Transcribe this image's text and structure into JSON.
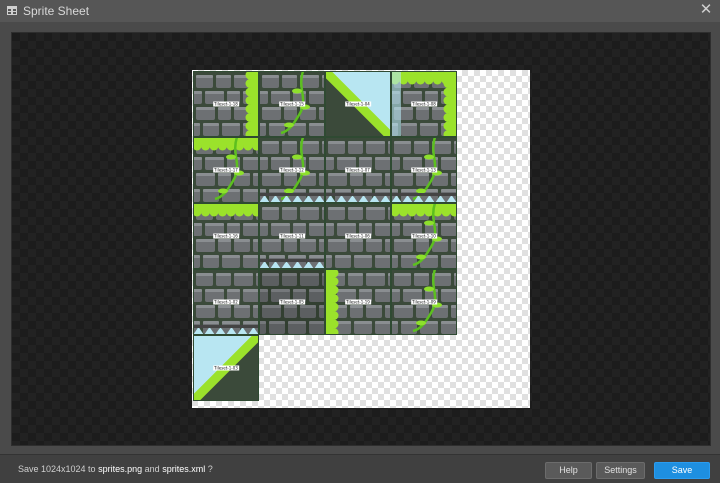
{
  "window": {
    "title": "Sprite Sheet",
    "close_glyph": "✕"
  },
  "sheet": {
    "tiles": [
      {
        "label": "Tileset-1-18",
        "variant": "wall-grass-right"
      },
      {
        "label": "Tileset-1-15",
        "variant": "wall-vine"
      },
      {
        "label": "Tileset-1-04",
        "variant": "slope-down"
      },
      {
        "label": "Tileset-1-08",
        "variant": "corner-grass"
      },
      {
        "label": "Tileset-1-17",
        "variant": "wall-grass-top-vine"
      },
      {
        "label": "Tileset-1-12",
        "variant": "wall-vine-bottom"
      },
      {
        "label": "Tileset-1-07",
        "variant": "wall-bottom"
      },
      {
        "label": "Tileset-1-13",
        "variant": "wall-vine-bottom"
      },
      {
        "label": "Tileset-1-16",
        "variant": "wall-grass-top"
      },
      {
        "label": "Tileset-1-11",
        "variant": "wall-bottom"
      },
      {
        "label": "Tileset-1-06",
        "variant": "wall"
      },
      {
        "label": "Tileset-1-10",
        "variant": "wall-grass-top-vine"
      },
      {
        "label": "Tileset-1-02",
        "variant": "wall-grass-bottom"
      },
      {
        "label": "Tileset-1-05",
        "variant": "wall-dark"
      },
      {
        "label": "Tileset-1-19",
        "variant": "wall-grass-left"
      },
      {
        "label": "Tileset-1-09",
        "variant": "wall-vine-left"
      },
      {
        "label": "Tileset-1-03",
        "variant": "slope-up"
      }
    ]
  },
  "footer": {
    "status_prefix": "Save 1024x1024 to",
    "png_file": "sprites.png",
    "and_word": "and",
    "xml_file": "sprites.xml",
    "status_suffix": "?",
    "help_label": "Help",
    "settings_label": "Settings",
    "save_label": "Save"
  },
  "colors": {
    "accent": "#1e8fe0",
    "grass": "#9be22b",
    "stone": "#6d7073",
    "mortar": "#3b4a3a",
    "sky": "#b8e6f2"
  },
  "icons": {
    "title": "spritesheet-icon",
    "close": "close-icon"
  }
}
